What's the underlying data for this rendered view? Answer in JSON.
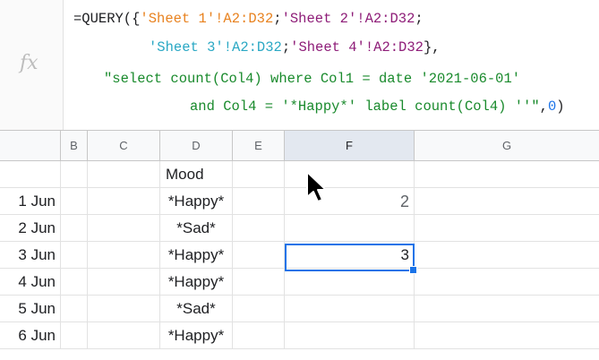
{
  "formula_bar": {
    "fx_label": "fx",
    "line1": {
      "p1": "=QUERY({",
      "p2": "'Sheet 1'!A2:D32",
      "p3": ";",
      "p4": "'Sheet 2'!A2:D32",
      "p5": ";"
    },
    "line2": {
      "p1": "'Sheet 3'!A2:D32",
      "p2": ";",
      "p3": "'Sheet 4'!A2:D32",
      "p4": "},"
    },
    "line3": {
      "p1": "\"select count(Col4) where Col1 = date '2021-06-01'"
    },
    "line4": {
      "p1": "and Col4 = '*Happy*' label count(Col4) ''\"",
      "p2": ",",
      "p3": "0",
      "p4": ")"
    }
  },
  "columns": [
    "B",
    "C",
    "D",
    "E",
    "F",
    "G"
  ],
  "rows": [
    {
      "a": "",
      "d": "Mood",
      "f": ""
    },
    {
      "a": "1 Jun",
      "d": "*Happy*",
      "f": "2"
    },
    {
      "a": "2 Jun",
      "d": "*Sad*",
      "f": ""
    },
    {
      "a": "3 Jun",
      "d": "*Happy*",
      "f": "3"
    },
    {
      "a": "4 Jun",
      "d": "*Happy*",
      "f": ""
    },
    {
      "a": "5 Jun",
      "d": "*Sad*",
      "f": ""
    },
    {
      "a": "6 Jun",
      "d": "*Happy*",
      "f": ""
    }
  ],
  "colors": {
    "accent": "#1a73e8",
    "range1": "#e8821f",
    "range2": "#8e1d78",
    "range3": "#2aa8c4",
    "string": "#198a2c"
  }
}
